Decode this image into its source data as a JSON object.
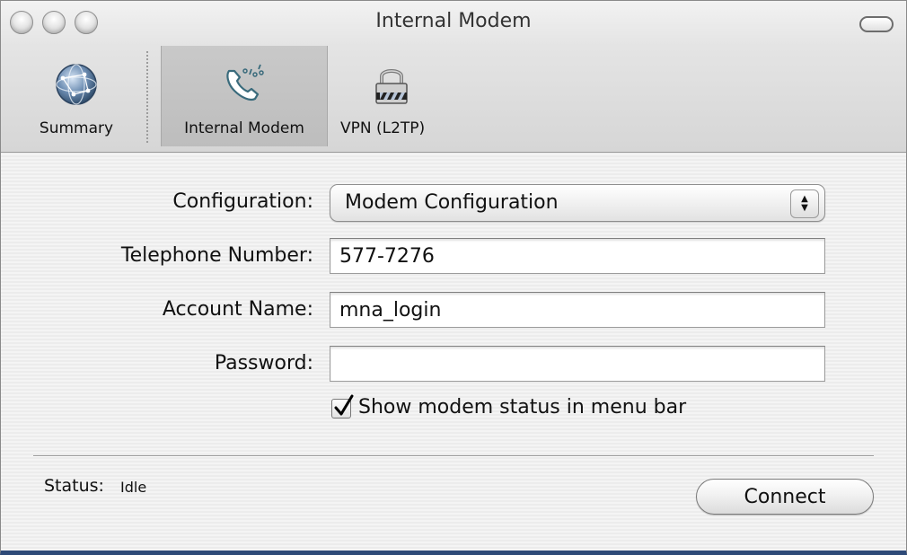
{
  "window": {
    "title": "Internal Modem"
  },
  "toolbar": {
    "items": [
      {
        "label": "Summary",
        "icon": "globe-network-icon",
        "selected": false
      },
      {
        "label": "Internal Modem",
        "icon": "telephone-modem-icon",
        "selected": true
      },
      {
        "label": "VPN (L2TP)",
        "icon": "padlock-icon",
        "selected": false
      }
    ]
  },
  "form": {
    "configuration": {
      "label": "Configuration:",
      "value": "Modem Configuration"
    },
    "telephone": {
      "label": "Telephone Number:",
      "value": "577-7276"
    },
    "account": {
      "label": "Account Name:",
      "value": "mna_login"
    },
    "password": {
      "label": "Password:",
      "value": ""
    },
    "show_status": {
      "label": "Show modem status in menu bar",
      "checked": true
    }
  },
  "footer": {
    "status_label": "Status:",
    "status_value": "Idle",
    "connect_label": "Connect"
  },
  "colors": {
    "window_bottom_border": "#2e4a78",
    "selected_tab": "#c4c4c4"
  }
}
